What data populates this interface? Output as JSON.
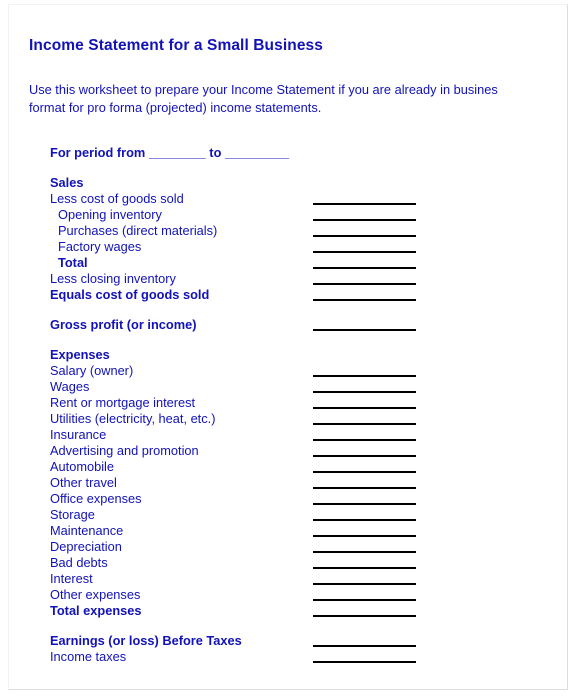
{
  "document": {
    "title": "Income Statement for a Small Business",
    "intro_line_1": "Use this worksheet to prepare your Income Statement if you are already in busines",
    "intro_line_2": "format for pro forma (projected) income statements.",
    "period_line": "For period from ________ to _________",
    "text_color": "#1212b8",
    "rule_color": "#000000"
  },
  "rows": [
    {
      "label": "Sales",
      "indent": 0,
      "bold": true,
      "rule": false,
      "gap": false
    },
    {
      "label": "Less cost of goods sold",
      "indent": 0,
      "bold": false,
      "rule": true,
      "gap": false
    },
    {
      "label": "Opening inventory",
      "indent": 1,
      "bold": false,
      "rule": true,
      "gap": false
    },
    {
      "label": "Purchases (direct materials)",
      "indent": 1,
      "bold": false,
      "rule": true,
      "gap": false
    },
    {
      "label": "Factory wages",
      "indent": 1,
      "bold": false,
      "rule": true,
      "gap": false
    },
    {
      "label": "Total",
      "indent": 1,
      "bold": true,
      "rule": true,
      "gap": false
    },
    {
      "label": "Less closing inventory",
      "indent": 0,
      "bold": false,
      "rule": true,
      "gap": false
    },
    {
      "label": "Equals cost of goods sold",
      "indent": 0,
      "bold": true,
      "rule": true,
      "gap": false
    },
    {
      "label": "Gross profit (or income)",
      "indent": 0,
      "bold": true,
      "rule": true,
      "gap": true
    },
    {
      "label": "Expenses",
      "indent": 0,
      "bold": true,
      "rule": false,
      "gap": true
    },
    {
      "label": "Salary (owner)",
      "indent": 0,
      "bold": false,
      "rule": true,
      "gap": false
    },
    {
      "label": "Wages",
      "indent": 0,
      "bold": false,
      "rule": true,
      "gap": false
    },
    {
      "label": "Rent or mortgage interest",
      "indent": 0,
      "bold": false,
      "rule": true,
      "gap": false
    },
    {
      "label": "Utilities (electricity, heat, etc.)",
      "indent": 0,
      "bold": false,
      "rule": true,
      "gap": false
    },
    {
      "label": "Insurance",
      "indent": 0,
      "bold": false,
      "rule": true,
      "gap": false
    },
    {
      "label": "Advertising and promotion",
      "indent": 0,
      "bold": false,
      "rule": true,
      "gap": false
    },
    {
      "label": "Automobile",
      "indent": 0,
      "bold": false,
      "rule": true,
      "gap": false
    },
    {
      "label": "Other travel",
      "indent": 0,
      "bold": false,
      "rule": true,
      "gap": false
    },
    {
      "label": "Office expenses",
      "indent": 0,
      "bold": false,
      "rule": true,
      "gap": false
    },
    {
      "label": "Storage",
      "indent": 0,
      "bold": false,
      "rule": true,
      "gap": false
    },
    {
      "label": "Maintenance",
      "indent": 0,
      "bold": false,
      "rule": true,
      "gap": false
    },
    {
      "label": "Depreciation",
      "indent": 0,
      "bold": false,
      "rule": true,
      "gap": false
    },
    {
      "label": "Bad debts",
      "indent": 0,
      "bold": false,
      "rule": true,
      "gap": false
    },
    {
      "label": "Interest",
      "indent": 0,
      "bold": false,
      "rule": true,
      "gap": false
    },
    {
      "label": "Other expenses",
      "indent": 0,
      "bold": false,
      "rule": true,
      "gap": false
    },
    {
      "label": "Total expenses",
      "indent": 0,
      "bold": true,
      "rule": true,
      "gap": false
    },
    {
      "label": "Earnings (or loss) Before Taxes",
      "indent": 0,
      "bold": true,
      "rule": true,
      "gap": true
    },
    {
      "label": "Income taxes",
      "indent": 0,
      "bold": false,
      "rule": true,
      "gap": false
    }
  ]
}
